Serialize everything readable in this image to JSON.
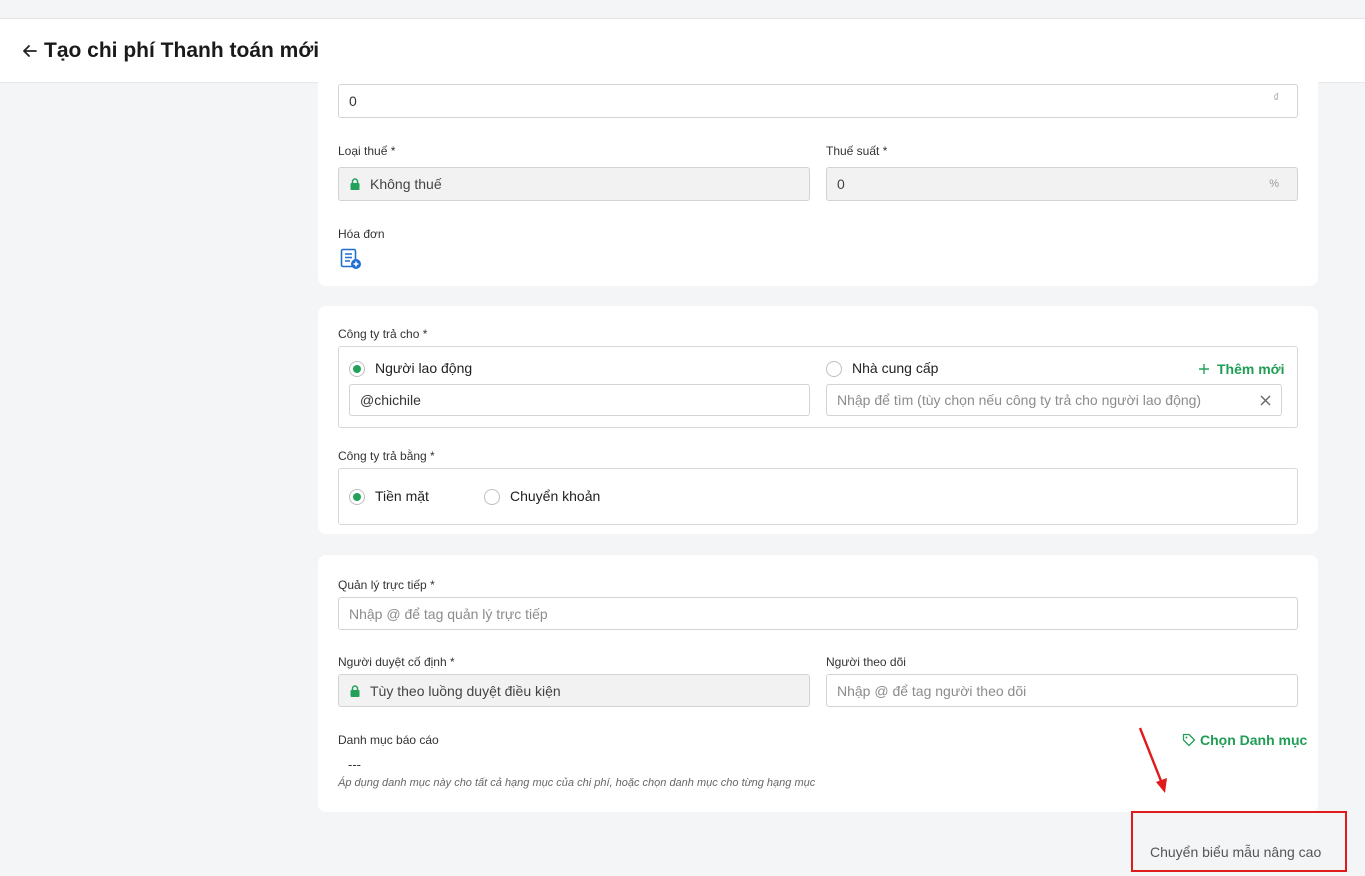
{
  "header": {
    "title": "Tạo chi phí Thanh toán mới"
  },
  "amount": {
    "value": "0",
    "currency": "₫"
  },
  "tax": {
    "type_label": "Loại thuế *",
    "type_value": "Không thuế",
    "rate_label": "Thuế suất *",
    "rate_value": "0",
    "rate_unit": "%"
  },
  "invoice": {
    "label": "Hóa đơn"
  },
  "payee": {
    "label": "Công ty trả cho *",
    "option_employee": "Người lao động",
    "option_supplier": "Nhà cung cấp",
    "add_new": "Thêm mới",
    "employee_value": "@chichile",
    "supplier_placeholder": "Nhập để tìm (tùy chọn nếu công ty trả cho người lao động)"
  },
  "payment_method": {
    "label": "Công ty trả bằng *",
    "option_cash": "Tiền mặt",
    "option_transfer": "Chuyển khoản"
  },
  "manager": {
    "label": "Quản lý trực tiếp *",
    "placeholder": "Nhập @ để tag quản lý trực tiếp"
  },
  "approver": {
    "label": "Người duyệt cố định *",
    "value": "Tùy theo luồng duyệt điều kiện"
  },
  "follower": {
    "label": "Người theo dõi",
    "placeholder": "Nhập @ để tag người theo dõi"
  },
  "report_category": {
    "label": "Danh mục báo cáo",
    "choose": "Chọn Danh mục",
    "value": "---",
    "hint": "Áp dụng danh mục này cho tất cả hạng mục của chi phí, hoặc chọn danh mục cho từng hạng mục"
  },
  "advanced": {
    "label": "Chuyển biểu mẫu nâng cao"
  },
  "colors": {
    "accent": "#23a15a",
    "annotation": "#e01b1b"
  }
}
